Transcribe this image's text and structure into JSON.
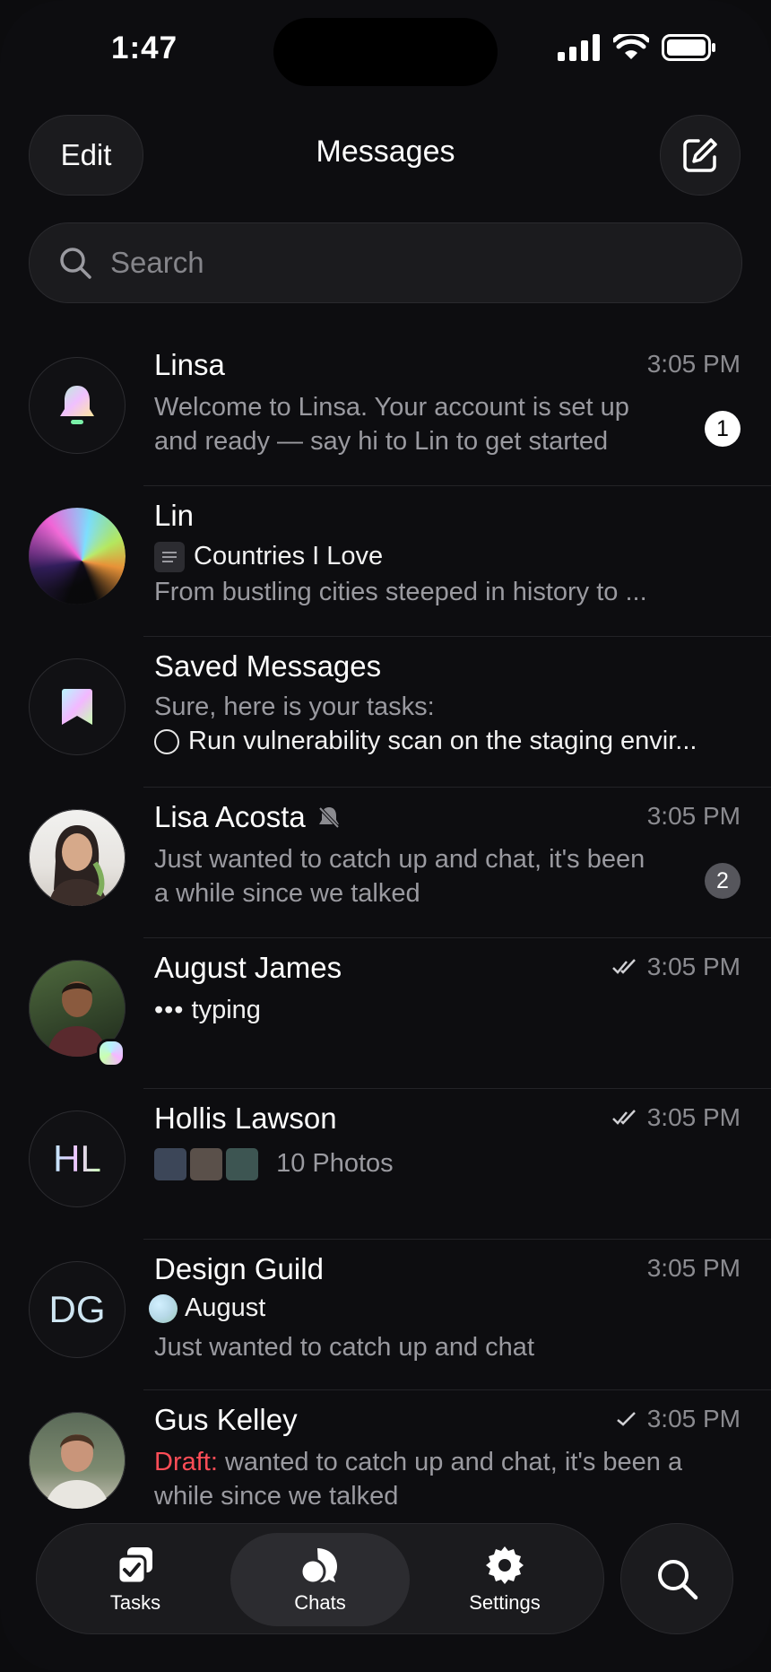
{
  "status_bar": {
    "time": "1:47"
  },
  "header": {
    "edit_label": "Edit",
    "title": "Messages"
  },
  "search": {
    "placeholder": "Search"
  },
  "chats": [
    {
      "name": "Linsa",
      "time": "3:05 PM",
      "line1": "Welcome to Linsa. Your account is set up",
      "line2": "and ready — say hi to Lin to get started",
      "unread": "1"
    },
    {
      "name": "Lin",
      "doc_title": "Countries I Love",
      "preview": "From bustling cities steeped in history to ..."
    },
    {
      "name": "Saved Messages",
      "line1": "Sure, here is your tasks:",
      "task": "Run vulnerability scan on the staging envir..."
    },
    {
      "name": "Lisa Acosta",
      "time": "3:05 PM",
      "line1": "Just wanted to catch up and chat, it's been",
      "line2": "a while since we talked",
      "unread": "2",
      "muted": true
    },
    {
      "name": "August James",
      "time": "3:05 PM",
      "status": "typing"
    },
    {
      "name": "Hollis Lawson",
      "initials": "HL",
      "time": "3:05 PM",
      "attachment": "10 Photos"
    },
    {
      "name": "Design Guild",
      "initials": "DG",
      "time": "3:05 PM",
      "sender": "August",
      "preview": "Just wanted to catch up and chat"
    },
    {
      "name": "Gus Kelley",
      "time": "3:05 PM",
      "draft_label": "Draft:",
      "line1": " wanted to catch up and chat, it's been a",
      "line2": "while since we talked"
    }
  ],
  "tabbar": {
    "tasks": "Tasks",
    "chats": "Chats",
    "settings": "Settings"
  },
  "colors": {
    "background": "#0d0d10",
    "surface": "#1b1b1e",
    "draft": "#ff4d57",
    "secondary_text": "#9a9aa0"
  }
}
